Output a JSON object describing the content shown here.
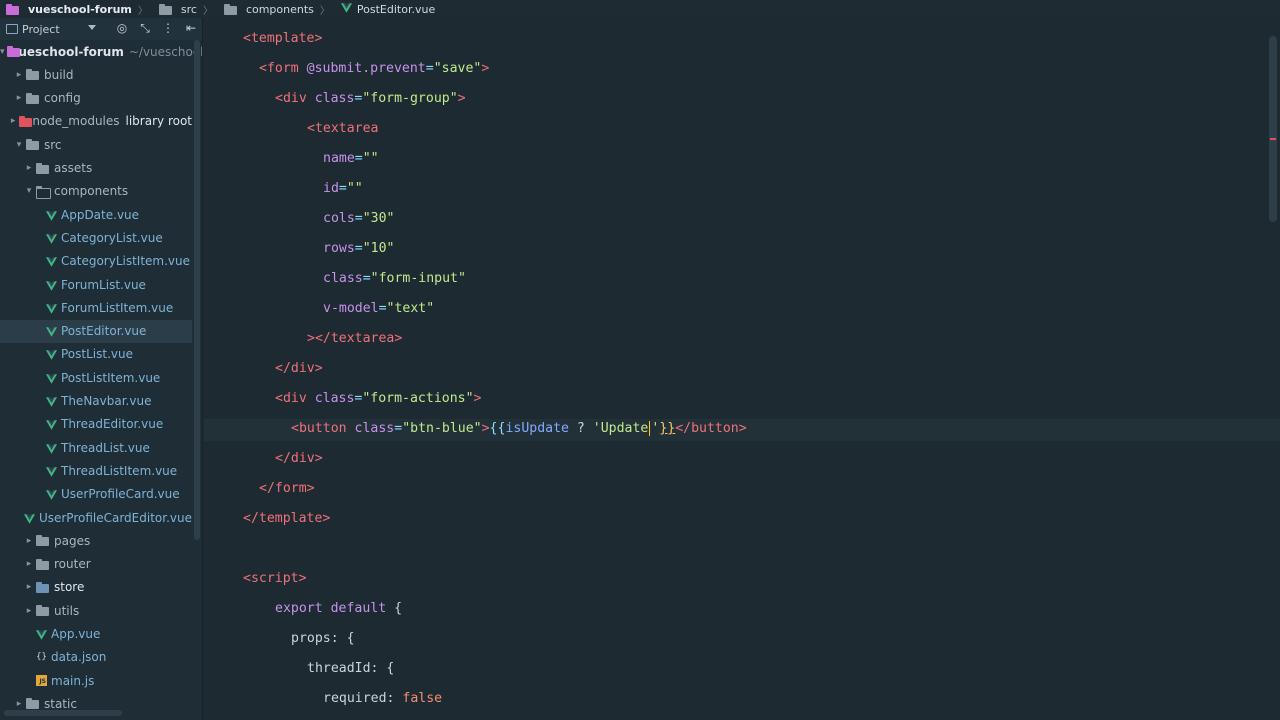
{
  "breadcrumb": [
    "vueschool-forum",
    "src",
    "components",
    "PostEditor.vue"
  ],
  "project_panel": {
    "title": "Project",
    "tree": [
      {
        "label": "vueschool-forum",
        "hint": "~/vueschool",
        "kind": "root",
        "depth": 0,
        "open": true
      },
      {
        "label": "build",
        "kind": "folder",
        "depth": 1,
        "open": false
      },
      {
        "label": "config",
        "kind": "folder",
        "depth": 1,
        "open": false
      },
      {
        "label": "node_modules",
        "hint": "library root",
        "kind": "folder-red",
        "depth": 1,
        "open": false
      },
      {
        "label": "src",
        "kind": "folder",
        "depth": 1,
        "open": true
      },
      {
        "label": "assets",
        "kind": "folder",
        "depth": 2,
        "open": false
      },
      {
        "label": "components",
        "kind": "folder-open",
        "depth": 2,
        "open": true
      },
      {
        "label": "AppDate.vue",
        "kind": "vue",
        "depth": 3
      },
      {
        "label": "CategoryList.vue",
        "kind": "vue",
        "depth": 3
      },
      {
        "label": "CategoryListItem.vue",
        "kind": "vue",
        "depth": 3
      },
      {
        "label": "ForumList.vue",
        "kind": "vue",
        "depth": 3
      },
      {
        "label": "ForumListItem.vue",
        "kind": "vue",
        "depth": 3
      },
      {
        "label": "PostEditor.vue",
        "kind": "vue",
        "depth": 3,
        "selected": true
      },
      {
        "label": "PostList.vue",
        "kind": "vue",
        "depth": 3
      },
      {
        "label": "PostListItem.vue",
        "kind": "vue",
        "depth": 3
      },
      {
        "label": "TheNavbar.vue",
        "kind": "vue",
        "depth": 3
      },
      {
        "label": "ThreadEditor.vue",
        "kind": "vue",
        "depth": 3
      },
      {
        "label": "ThreadList.vue",
        "kind": "vue",
        "depth": 3
      },
      {
        "label": "ThreadListItem.vue",
        "kind": "vue",
        "depth": 3
      },
      {
        "label": "UserProfileCard.vue",
        "kind": "vue",
        "depth": 3
      },
      {
        "label": "UserProfileCardEditor.vue",
        "kind": "vue",
        "depth": 3
      },
      {
        "label": "pages",
        "kind": "folder",
        "depth": 2,
        "open": false
      },
      {
        "label": "router",
        "kind": "folder",
        "depth": 2,
        "open": false
      },
      {
        "label": "store",
        "kind": "folder-blue",
        "depth": 2,
        "open": false
      },
      {
        "label": "utils",
        "kind": "folder",
        "depth": 2,
        "open": false
      },
      {
        "label": "App.vue",
        "kind": "vue",
        "depth": 2
      },
      {
        "label": "data.json",
        "kind": "json",
        "depth": 2
      },
      {
        "label": "main.js",
        "kind": "js",
        "depth": 2
      },
      {
        "label": "static",
        "kind": "folder",
        "depth": 1,
        "open": false
      }
    ]
  },
  "code": [
    {
      "indent": 0,
      "tokens": [
        [
          "tag",
          "<template>"
        ]
      ]
    },
    {
      "indent": 1,
      "tokens": [
        [
          "tag",
          "<form "
        ],
        [
          "attr",
          "@submit.prevent"
        ],
        [
          "punc",
          "="
        ],
        [
          "str",
          "\"save\""
        ],
        [
          "tag",
          ">"
        ]
      ]
    },
    {
      "indent": 2,
      "tokens": [
        [
          "tag",
          "<div "
        ],
        [
          "attr",
          "class"
        ],
        [
          "punc",
          "="
        ],
        [
          "str",
          "\"form-group\""
        ],
        [
          "tag",
          ">"
        ]
      ]
    },
    {
      "indent": 4,
      "tokens": [
        [
          "tag",
          "<textarea"
        ]
      ]
    },
    {
      "indent": 5,
      "tokens": [
        [
          "attr",
          "name"
        ],
        [
          "punc",
          "="
        ],
        [
          "str",
          "\"\""
        ]
      ]
    },
    {
      "indent": 5,
      "tokens": [
        [
          "attr",
          "id"
        ],
        [
          "punc",
          "="
        ],
        [
          "str",
          "\"\""
        ]
      ]
    },
    {
      "indent": 5,
      "tokens": [
        [
          "attr",
          "cols"
        ],
        [
          "punc",
          "="
        ],
        [
          "str",
          "\"30\""
        ]
      ]
    },
    {
      "indent": 5,
      "tokens": [
        [
          "attr",
          "rows"
        ],
        [
          "punc",
          "="
        ],
        [
          "str",
          "\"10\""
        ]
      ]
    },
    {
      "indent": 5,
      "tokens": [
        [
          "attr",
          "class"
        ],
        [
          "punc",
          "="
        ],
        [
          "str",
          "\"form-input\""
        ]
      ]
    },
    {
      "indent": 5,
      "tokens": [
        [
          "attr",
          "v-model"
        ],
        [
          "punc",
          "="
        ],
        [
          "str",
          "\"text\""
        ]
      ]
    },
    {
      "indent": 4,
      "tokens": [
        [
          "tag",
          "></textarea>"
        ]
      ]
    },
    {
      "indent": 2,
      "tokens": [
        [
          "tag",
          "</div>"
        ]
      ]
    },
    {
      "indent": 2,
      "tokens": [
        [
          "tag",
          "<div "
        ],
        [
          "attr",
          "class"
        ],
        [
          "punc",
          "="
        ],
        [
          "str",
          "\"form-actions\""
        ],
        [
          "tag",
          ">"
        ]
      ]
    },
    {
      "indent": 3,
      "tokens": [
        [
          "tag",
          "<button "
        ],
        [
          "attr",
          "class"
        ],
        [
          "punc",
          "="
        ],
        [
          "str",
          "\"btn-blue\""
        ],
        [
          "tag",
          ">"
        ],
        [
          "brace",
          "{{"
        ],
        [
          "prop",
          "isUpdate"
        ],
        [
          "tern",
          " ? "
        ],
        [
          "str",
          "'Update"
        ],
        [
          "caret",
          ""
        ],
        [
          "str",
          "'"
        ],
        [
          "hlbrace",
          "}}"
        ],
        [
          "tag",
          "</button>"
        ]
      ]
    },
    {
      "indent": 2,
      "tokens": [
        [
          "tag",
          "</div>"
        ]
      ]
    },
    {
      "indent": 1,
      "tokens": [
        [
          "tag",
          "</form>"
        ]
      ]
    },
    {
      "indent": 0,
      "tokens": [
        [
          "tag",
          "</template>"
        ]
      ]
    },
    {
      "indent": 0,
      "tokens": []
    },
    {
      "indent": 0,
      "tokens": [
        [
          "tag",
          "<script>"
        ]
      ]
    },
    {
      "indent": 2,
      "tokens": [
        [
          "kw",
          "export default "
        ],
        [
          "plain",
          "{"
        ]
      ]
    },
    {
      "indent": 3,
      "tokens": [
        [
          "plain",
          "props: {"
        ]
      ]
    },
    {
      "indent": 4,
      "tokens": [
        [
          "plain",
          "threadId: {"
        ]
      ]
    },
    {
      "indent": 5,
      "tokens": [
        [
          "plain",
          "required: "
        ],
        [
          "bool",
          "false"
        ]
      ]
    }
  ],
  "colors": {
    "editor_bg": "#1d2a32",
    "tag": "#f07178",
    "attr": "#c792ea",
    "string": "#c3e88d",
    "caret": "#ffcc00"
  }
}
